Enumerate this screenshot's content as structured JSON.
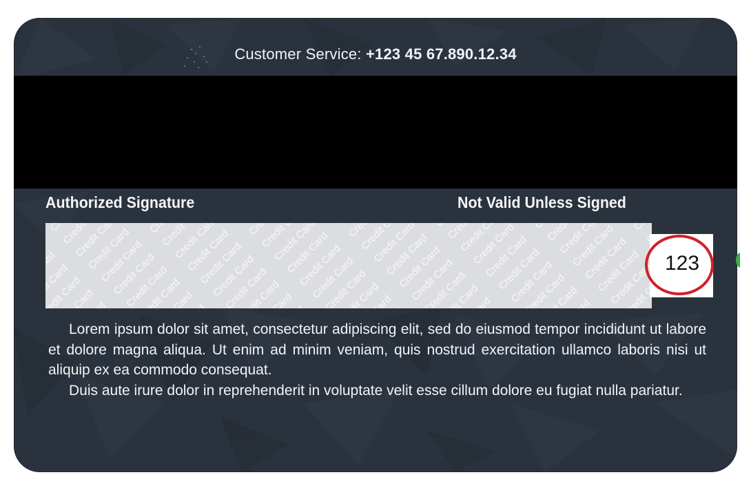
{
  "card": {
    "customer_service_label": "Customer Service:",
    "customer_service_number": "+123 45 67.890.12.34",
    "authorized_signature_label": "Authorized Signature",
    "not_valid_label": "Not Valid Unless Signed",
    "signature_panel_pattern_text": "Credit Card",
    "cvv": "123",
    "terms_paragraph_1": "Lorem ipsum dolor sit amet, consectetur adipiscing elit, sed do eiusmod tempor incididunt ut labore et dolore magna aliqua. Ut enim ad minim veniam, quis nostrud exercitation ullamco laboris nisi ut aliquip ex ea commodo consequat.",
    "terms_paragraph_2": "Duis aute irure dolor in reprehenderit in voluptate velit esse cillum dolore eu fugiat nulla pariatur."
  },
  "colors": {
    "card_background": "#2a323d",
    "magnetic_stripe": "#000000",
    "signature_panel": "#dcdde0",
    "highlight_circle": "#d0202a",
    "text": "#f2f4f6"
  }
}
